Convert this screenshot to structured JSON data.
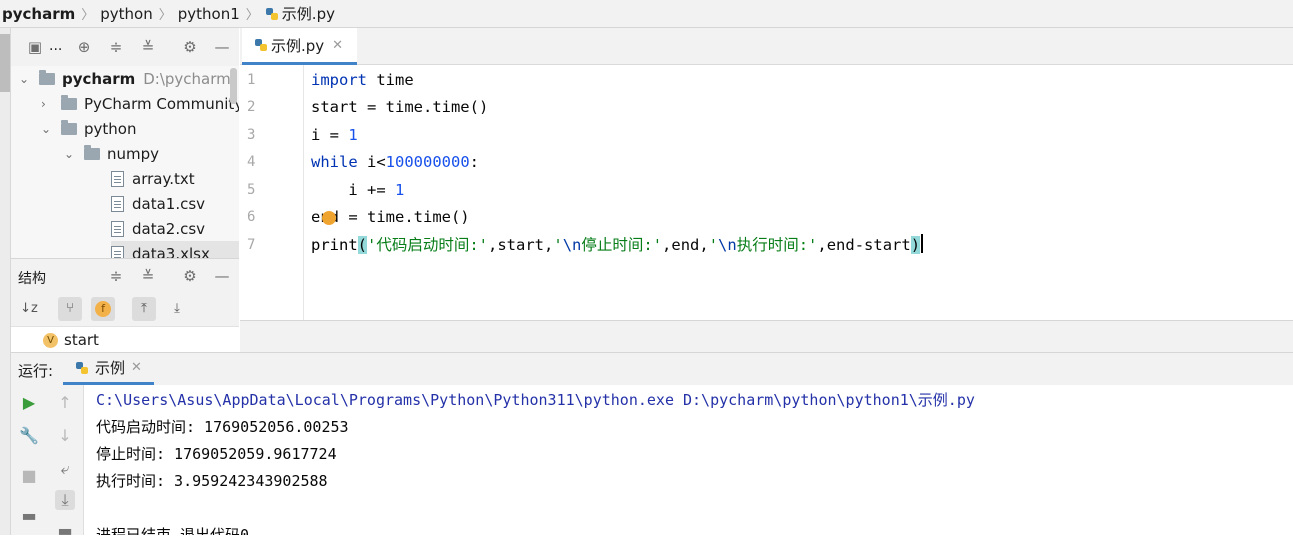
{
  "breadcrumb": [
    "pycharm",
    "python",
    "python1",
    "示例.py"
  ],
  "project_panel": {
    "title": "...",
    "tree": [
      {
        "label": "pycharm",
        "path": "D:\\pycharm"
      },
      {
        "label": "PyCharm Community"
      },
      {
        "label": "python"
      },
      {
        "label": "numpy"
      },
      {
        "label": "array.txt"
      },
      {
        "label": "data1.csv"
      },
      {
        "label": "data2.csv"
      },
      {
        "label": "data3.xlsx"
      }
    ]
  },
  "structure_panel": {
    "title": "结构",
    "badge_f": "f",
    "item_badge": "V",
    "items": [
      "start"
    ]
  },
  "editor": {
    "tab_label": "示例.py",
    "line_numbers": [
      "1",
      "2",
      "3",
      "4",
      "5",
      "6",
      "7"
    ],
    "code": {
      "l1_kw": "import",
      "l1_rest": " time",
      "l2": "start = time.time()",
      "l3_a": "i = ",
      "l3_num": "1",
      "l4_kw": "while",
      "l4_a": " i<",
      "l4_num": "100000000",
      "l4_b": ":",
      "l5_a": "    i += ",
      "l5_num": "1",
      "l6": "end = time.time()",
      "l7_fn": "print",
      "l7_open": "(",
      "l7_s1": "'代码启动时间:'",
      "l7_a": ",start,",
      "l7_s2a": "'",
      "l7_s2esc": "\\n",
      "l7_s2b": "停止时间:'",
      "l7_b": ",end,",
      "l7_s3a": "'",
      "l7_s3esc": "\\n",
      "l7_s3b": "执行时间:'",
      "l7_c": ",end-start",
      "l7_close": ")"
    }
  },
  "run_panel": {
    "label": "运行:",
    "tab_label": "示例",
    "output": [
      "C:\\Users\\Asus\\AppData\\Local\\Programs\\Python\\Python311\\python.exe D:\\pycharm\\python\\python1\\示例.py",
      "代码启动时间: 1769052056.00253",
      "停止时间: 1769052059.9617724",
      "执行时间: 3.959242343902588",
      "",
      "进程已结束,退出代码0"
    ]
  }
}
